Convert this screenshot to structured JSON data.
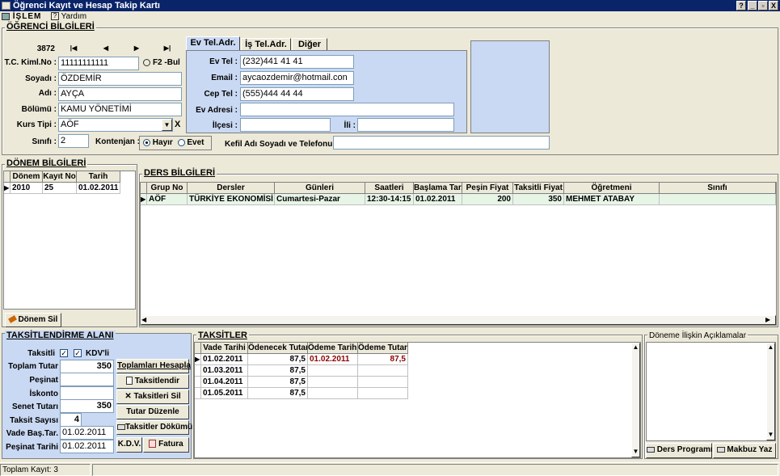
{
  "window": {
    "title": "Öğrenci Kayıt ve Hesap Takip Kartı",
    "help_btn": "?",
    "min_btn": "_",
    "max_btn": "▫",
    "close_btn": "X"
  },
  "menu": {
    "islem": "İŞLEM",
    "yardim": "Yardım"
  },
  "ogrenci": {
    "title": "ÖĞRENCİ BİLGİLERİ",
    "record_no": "3872",
    "nav_first": "|◀",
    "nav_prev": "◀",
    "nav_next": "▶",
    "nav_last": "▶|",
    "tc_label": "T.C. Kiml.No :",
    "tc_value": "11111111111",
    "f2_label": "F2 -Bul",
    "soyadi_label": "Soyadı :",
    "soyadi_value": "ÖZDEMİR",
    "adi_label": "Adı :",
    "adi_value": "AYÇA",
    "bolumu_label": "Bölümü :",
    "bolumu_value": "KAMU YÖNETİMİ",
    "kurs_label": "Kurs Tipi :",
    "kurs_value": "AÖF",
    "kurs_clear": "X",
    "sinif_label": "Sınıfı :",
    "sinif_value": "2",
    "kontenjan_label": "Kontenjan :",
    "hayir": "Hayır",
    "evet": "Evet",
    "kefil_label": "Kefil Adı Soyadı ve Telefonu :",
    "kefil_value": ""
  },
  "tabs": {
    "ev": "Ev Tel.Adr.",
    "is": "İş Tel.Adr.",
    "diger": "Diğer"
  },
  "contact": {
    "evtel_label": "Ev Tel :",
    "evtel_value": "(232)441 41 41",
    "email_label": "Email :",
    "email_value": "aycaozdemir@hotmail.con",
    "ceptel_label": "Cep Tel :",
    "ceptel_value": "(555)444 44 44",
    "adres_label": "Ev Adresi :",
    "adres_value": "",
    "ilce_label": "İlçesi :",
    "ilce_value": "",
    "il_label": "İli :",
    "il_value": ""
  },
  "donem": {
    "title": "DÖNEM BİLGİLERİ",
    "headers": [
      "Dönem",
      "Kayıt No",
      "Tarih"
    ],
    "rows": [
      [
        "2010",
        "25",
        "01.02.2011"
      ]
    ],
    "sil_btn": "Dönem Sil"
  },
  "ders": {
    "title": "DERS BİLGİLERİ",
    "headers": [
      "Grup No",
      "Dersler",
      "Günleri",
      "Saatleri",
      "Başlama Tar.",
      "Peşin Fiyat",
      "Taksitli Fiyat",
      "Öğretmeni",
      "Sınıfı"
    ],
    "rows": [
      [
        "AÖF",
        "TÜRKİYE EKONOMİSİ",
        "Cumartesi-Pazar",
        "12:30-14:15",
        "01.02.2011",
        "200",
        "350",
        "MEHMET ATABAY",
        ""
      ]
    ]
  },
  "taksitlendirme": {
    "title": "TAKSİTLENDİRME ALANI",
    "taksitli_label": "Taksitli",
    "kdvli_label": "KDV'li",
    "toplam_label": "Toplam Tutar",
    "toplam_value": "350",
    "pesinat_label": "Peşinat",
    "pesinat_value": "",
    "iskonto_label": "İskonto",
    "iskonto_value": "",
    "senet_label": "Senet Tutarı",
    "senet_value": "350",
    "sayisi_label": "Taksit Sayısı",
    "sayisi_value": "4",
    "vade_label": "Vade Baş.Tar.",
    "vade_value": "01.02.2011",
    "pesinat_tarihi_label": "Peşinat Tarihi",
    "pesinat_tarihi_value": "01.02.2011",
    "hesapla_btn": "Toplamları Hesapla",
    "taksitlendir_btn": "Taksitlendir",
    "sil_btn": "Taksitleri Sil",
    "duzenle_btn": "Tutar Düzenle",
    "dokum_btn": "Taksitler Dökümü",
    "kdv_btn": "K.D.V.",
    "fatura_btn": "Fatura"
  },
  "taksitler": {
    "title": "TAKSİTLER",
    "headers": [
      "Vade Tarihi",
      "Ödenecek Tutar",
      "Ödeme Tarihi",
      "Ödeme Tutarı"
    ],
    "rows": [
      [
        "01.02.2011",
        "87,5",
        "01.02.2011",
        "87,5"
      ],
      [
        "01.03.2011",
        "87,5",
        "",
        ""
      ],
      [
        "01.04.2011",
        "87,5",
        "",
        ""
      ],
      [
        "01.05.2011",
        "87,5",
        "",
        ""
      ]
    ]
  },
  "aciklama": {
    "title": "Döneme İlişkin Açıklamalar",
    "ders_programi_btn": "Ders Programı",
    "makbuz_btn": "Makbuz Yaz"
  },
  "status": {
    "toplam_kayit": "Toplam Kayıt: 3"
  },
  "colors": {
    "titlebar": "#0a246a",
    "panel_blue": "#c9d9f3",
    "selected_row": "#e7f5e7",
    "paid_red": "#8b0000"
  }
}
